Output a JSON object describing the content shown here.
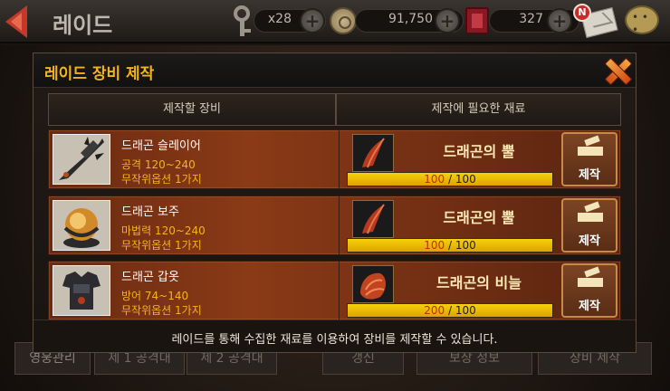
{
  "topbar": {
    "title": "레이드",
    "keys": "x28",
    "gold": "91,750",
    "gems": "327",
    "mail_badge": "N"
  },
  "bottom_tabs": [
    "영웅관리",
    "제 1 공격대",
    "제 2 공격대",
    "갱신",
    "보상 정보",
    "장비 제작"
  ],
  "modal": {
    "title": "레이드 장비 제작",
    "col_equipment": "제작할 장비",
    "col_materials": "제작에 필요한 재료",
    "footer": "레이드를 통해 수집한 재료를 이용하여 장비를 제작할 수 있습니다.",
    "items": [
      {
        "name": "드래곤 슬레이어",
        "stat": "공격 120~240",
        "option": "무작위옵션 1가지",
        "material": "드래곤의 뿔",
        "current": "100",
        "required": "100",
        "progress": 1.0,
        "button": "제작"
      },
      {
        "name": "드래곤 보주",
        "stat": "마법력 120~240",
        "option": "무작위옵션 1가지",
        "material": "드래곤의 뿔",
        "current": "100",
        "required": "100",
        "progress": 1.0,
        "button": "제작"
      },
      {
        "name": "드래곤 갑옷",
        "stat": "방어 74~140",
        "option": "무작위옵션 1가지",
        "material": "드래곤의 비늘",
        "current": "200",
        "required": "100",
        "progress": 1.0,
        "button": "제작"
      }
    ]
  },
  "colors": {
    "accent_gold": "#f5b31a",
    "row_bg": "#8a3a16",
    "progress_fill": "#f5d20c"
  }
}
